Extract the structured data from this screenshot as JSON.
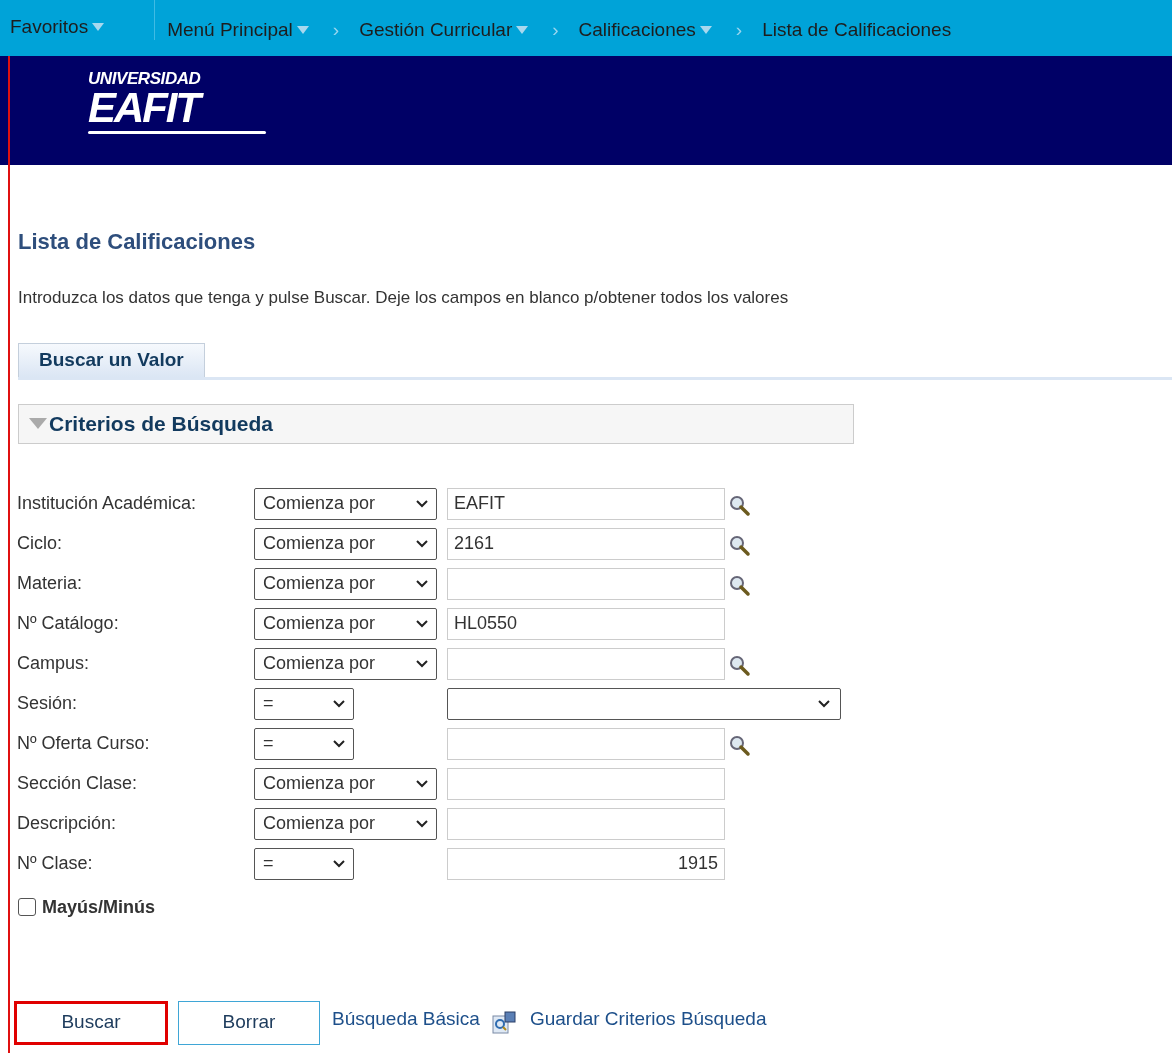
{
  "nav": [
    {
      "label": "Favoritos",
      "caret": true
    },
    {
      "label": "Menú Principal",
      "caret": true
    },
    {
      "label": "Gestión Curricular",
      "caret": true,
      "separator": "›"
    },
    {
      "label": "Calificaciones",
      "caret": true,
      "separator": "›"
    },
    {
      "label": "Lista de Calificaciones",
      "caret": false,
      "separator": "›"
    }
  ],
  "logo": {
    "top": "UNIVERSIDAD",
    "main": "EAFIT"
  },
  "page_title": "Lista de Calificaciones",
  "instructions": "Introduzca los datos que tenga y pulse Buscar. Deje los campos en blanco p/obtener todos los valores",
  "tabs": [
    {
      "label": "Buscar un Valor",
      "selected": true
    }
  ],
  "section": {
    "title": "Criterios de Búsqueda",
    "expanded": true
  },
  "fields": [
    {
      "label": "Institución Académica:",
      "operator": "Comienza por",
      "kind": "text",
      "value": "EAFIT",
      "lookup": true
    },
    {
      "label": "Ciclo:",
      "operator": "Comienza por",
      "kind": "text",
      "value": "2161",
      "lookup": true
    },
    {
      "label": "Materia:",
      "operator": "Comienza por",
      "kind": "text",
      "lookup": true
    },
    {
      "label": "Nº Catálogo:",
      "operator": "Comienza por",
      "kind": "text",
      "value": "HL0550",
      "lookup": false
    },
    {
      "label": "Campus:",
      "operator": "Comienza por",
      "kind": "text",
      "lookup": true
    },
    {
      "label": "Sesión:",
      "operator": "=",
      "kind": "dropdown",
      "lookup": false
    },
    {
      "label": "Nº Oferta Curso:",
      "operator": "=",
      "kind": "text",
      "lookup": true
    },
    {
      "label": "Sección Clase:",
      "operator": "Comienza por",
      "kind": "text",
      "lookup": false
    },
    {
      "label": "Descripción:",
      "operator": "Comienza por",
      "kind": "text",
      "lookup": false
    },
    {
      "label": "Nº Clase:",
      "operator": "=",
      "kind": "number",
      "value": "1915",
      "lookup": false
    }
  ],
  "case_checkbox": {
    "label": "Mayús/Minús",
    "checked": false
  },
  "buttons": [
    {
      "label": "Buscar",
      "highlighted": true
    },
    {
      "label": "Borrar",
      "highlighted": false
    }
  ],
  "links": [
    {
      "label": "Búsqueda Básica",
      "icon": false
    },
    {
      "label": "Guardar Criterios Búsqueda",
      "icon": true
    }
  ]
}
